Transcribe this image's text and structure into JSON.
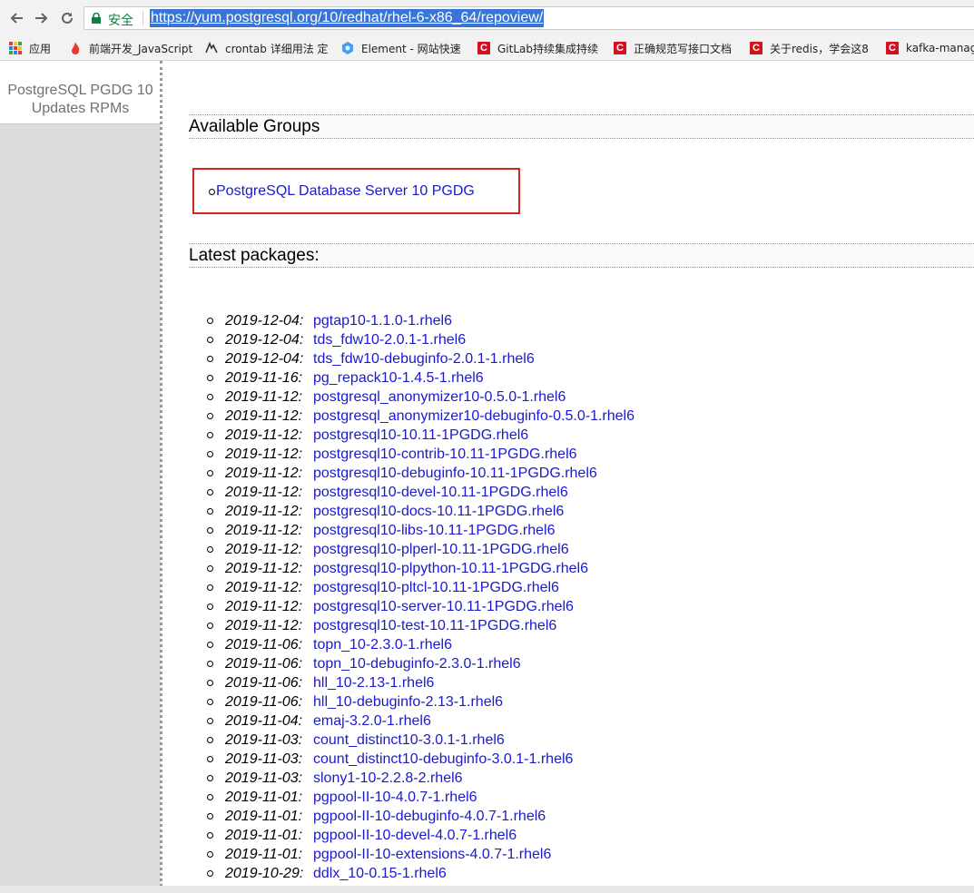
{
  "browser": {
    "secure_label": "安全",
    "url": "https://yum.postgresql.org/10/redhat/rhel-6-x86_64/repoview/",
    "bookmarks": [
      {
        "label": "应用",
        "icon": "apps-grid-icon"
      },
      {
        "label": "前端开发_JavaScript",
        "icon": "fire-icon"
      },
      {
        "label": "crontab 详细用法 定",
        "icon": "wolf-icon"
      },
      {
        "label": "Element - 网站快速",
        "icon": "element-icon"
      },
      {
        "label": "GitLab持续集成持续",
        "icon": "csdn-icon"
      },
      {
        "label": "正确规范写接口文档",
        "icon": "csdn-icon"
      },
      {
        "label": "关于redis，学会这8",
        "icon": "csdn-icon"
      },
      {
        "label": "kafka-manag",
        "icon": "csdn-icon"
      }
    ]
  },
  "sidebar": {
    "title_line1": "PostgreSQL PGDG 10",
    "title_line2": "Updates RPMs"
  },
  "main": {
    "groups_heading": "Available Groups",
    "groups": [
      "PostgreSQL Database Server 10 PGDG"
    ],
    "packages_heading": "Latest packages:",
    "packages": [
      {
        "date": "2019-12-04",
        "name": "pgtap10-1.1.0-1.rhel6"
      },
      {
        "date": "2019-12-04",
        "name": "tds_fdw10-2.0.1-1.rhel6"
      },
      {
        "date": "2019-12-04",
        "name": "tds_fdw10-debuginfo-2.0.1-1.rhel6"
      },
      {
        "date": "2019-11-16",
        "name": "pg_repack10-1.4.5-1.rhel6"
      },
      {
        "date": "2019-11-12",
        "name": "postgresql_anonymizer10-0.5.0-1.rhel6"
      },
      {
        "date": "2019-11-12",
        "name": "postgresql_anonymizer10-debuginfo-0.5.0-1.rhel6"
      },
      {
        "date": "2019-11-12",
        "name": "postgresql10-10.11-1PGDG.rhel6"
      },
      {
        "date": "2019-11-12",
        "name": "postgresql10-contrib-10.11-1PGDG.rhel6"
      },
      {
        "date": "2019-11-12",
        "name": "postgresql10-debuginfo-10.11-1PGDG.rhel6"
      },
      {
        "date": "2019-11-12",
        "name": "postgresql10-devel-10.11-1PGDG.rhel6"
      },
      {
        "date": "2019-11-12",
        "name": "postgresql10-docs-10.11-1PGDG.rhel6"
      },
      {
        "date": "2019-11-12",
        "name": "postgresql10-libs-10.11-1PGDG.rhel6"
      },
      {
        "date": "2019-11-12",
        "name": "postgresql10-plperl-10.11-1PGDG.rhel6"
      },
      {
        "date": "2019-11-12",
        "name": "postgresql10-plpython-10.11-1PGDG.rhel6"
      },
      {
        "date": "2019-11-12",
        "name": "postgresql10-pltcl-10.11-1PGDG.rhel6"
      },
      {
        "date": "2019-11-12",
        "name": "postgresql10-server-10.11-1PGDG.rhel6"
      },
      {
        "date": "2019-11-12",
        "name": "postgresql10-test-10.11-1PGDG.rhel6"
      },
      {
        "date": "2019-11-06",
        "name": "topn_10-2.3.0-1.rhel6"
      },
      {
        "date": "2019-11-06",
        "name": "topn_10-debuginfo-2.3.0-1.rhel6"
      },
      {
        "date": "2019-11-06",
        "name": "hll_10-2.13-1.rhel6"
      },
      {
        "date": "2019-11-06",
        "name": "hll_10-debuginfo-2.13-1.rhel6"
      },
      {
        "date": "2019-11-04",
        "name": "emaj-3.2.0-1.rhel6"
      },
      {
        "date": "2019-11-03",
        "name": "count_distinct10-3.0.1-1.rhel6"
      },
      {
        "date": "2019-11-03",
        "name": "count_distinct10-debuginfo-3.0.1-1.rhel6"
      },
      {
        "date": "2019-11-03",
        "name": "slony1-10-2.2.8-2.rhel6"
      },
      {
        "date": "2019-11-01",
        "name": "pgpool-II-10-4.0.7-1.rhel6"
      },
      {
        "date": "2019-11-01",
        "name": "pgpool-II-10-debuginfo-4.0.7-1.rhel6"
      },
      {
        "date": "2019-11-01",
        "name": "pgpool-II-10-devel-4.0.7-1.rhel6"
      },
      {
        "date": "2019-11-01",
        "name": "pgpool-II-10-extensions-4.0.7-1.rhel6"
      },
      {
        "date": "2019-10-29",
        "name": "ddlx_10-0.15-1.rhel6"
      }
    ]
  },
  "colors": {
    "link": "#1a1acc",
    "highlight_box": "#d22222",
    "secure": "#0b8043",
    "csdn": "#d1111b"
  }
}
